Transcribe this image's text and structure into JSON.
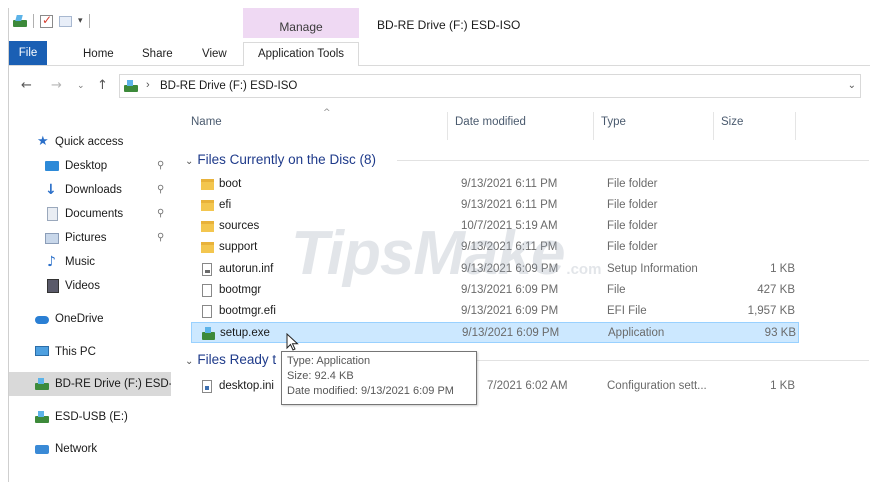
{
  "window": {
    "title": "BD-RE Drive (F:) ESD-ISO",
    "manage_label": "Manage"
  },
  "quick_access_toolbar": {
    "dropdown_label": "▾"
  },
  "ribbon": {
    "tabs": [
      {
        "label": "File"
      },
      {
        "label": "Home"
      },
      {
        "label": "Share"
      },
      {
        "label": "View"
      },
      {
        "label": "Application Tools"
      }
    ],
    "file_color": "#1a5fb4",
    "manage_color": "#efd9f3"
  },
  "nav": {
    "back": "←",
    "forward": "→",
    "recent": "⌄",
    "up": "↑",
    "path_separator": "›",
    "path": "BD-RE Drive (F:) ESD-ISO",
    "dropdown": "⌄"
  },
  "sidebar": {
    "items": [
      {
        "label": "Quick access",
        "icon": "star-icon"
      },
      {
        "label": "Desktop",
        "icon": "desktop-icon",
        "pinned": true
      },
      {
        "label": "Downloads",
        "icon": "download-icon",
        "pinned": true
      },
      {
        "label": "Documents",
        "icon": "document-icon",
        "pinned": true
      },
      {
        "label": "Pictures",
        "icon": "pictures-icon",
        "pinned": true
      },
      {
        "label": "Music",
        "icon": "music-icon"
      },
      {
        "label": "Videos",
        "icon": "videos-icon"
      },
      {
        "label": "OneDrive",
        "icon": "cloud-icon"
      },
      {
        "label": "This PC",
        "icon": "computer-icon"
      },
      {
        "label": "BD-RE Drive (F:) ESD-ISO",
        "icon": "disc-drive-icon",
        "selected": true
      },
      {
        "label": "ESD-USB (E:)",
        "icon": "usb-drive-icon"
      },
      {
        "label": "Network",
        "icon": "network-icon"
      }
    ],
    "pin_glyph": "⚲"
  },
  "columns": {
    "name": "Name",
    "date": "Date modified",
    "type": "Type",
    "size": "Size",
    "sort_glyph": "^"
  },
  "groups": [
    {
      "title": "Files Currently on the Disc (8)",
      "rows": [
        {
          "name": "boot",
          "date": "9/13/2021 6:11 PM",
          "type": "File folder",
          "size": "",
          "icon": "folder"
        },
        {
          "name": "efi",
          "date": "9/13/2021 6:11 PM",
          "type": "File folder",
          "size": "",
          "icon": "folder"
        },
        {
          "name": "sources",
          "date": "10/7/2021 5:19 AM",
          "type": "File folder",
          "size": "",
          "icon": "folder"
        },
        {
          "name": "support",
          "date": "9/13/2021 6:11 PM",
          "type": "File folder",
          "size": "",
          "icon": "folder"
        },
        {
          "name": "autorun.inf",
          "date": "9/13/2021 6:09 PM",
          "type": "Setup Information",
          "size": "1 KB",
          "icon": "inf"
        },
        {
          "name": "bootmgr",
          "date": "9/13/2021 6:09 PM",
          "type": "File",
          "size": "427 KB",
          "icon": "file"
        },
        {
          "name": "bootmgr.efi",
          "date": "9/13/2021 6:09 PM",
          "type": "EFI File",
          "size": "1,957 KB",
          "icon": "file"
        },
        {
          "name": "setup.exe",
          "date": "9/13/2021 6:09 PM",
          "type": "Application",
          "size": "93 KB",
          "icon": "app",
          "selected": true
        }
      ]
    },
    {
      "title": "Files Ready t",
      "rows": [
        {
          "name": "desktop.ini",
          "date": "7/2021 6:02 AM",
          "type": "Configuration sett...",
          "size": "1 KB",
          "icon": "ini"
        }
      ]
    }
  ],
  "tooltip": {
    "line1": "Type: Application",
    "line2": "Size: 92.4 KB",
    "line3": "Date modified: 9/13/2021 6:09 PM"
  },
  "watermark": {
    "main": "TipsMake",
    "suffix": ".com"
  }
}
